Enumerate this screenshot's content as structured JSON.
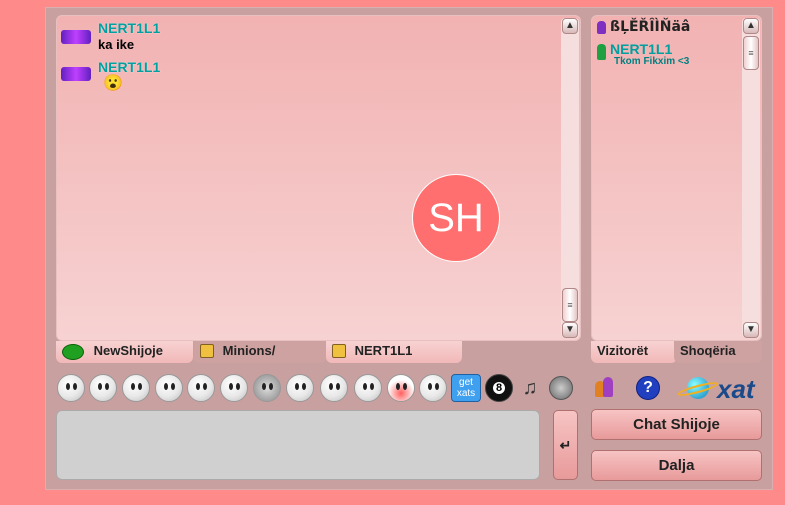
{
  "chat": {
    "messages": [
      {
        "user": "NERT1L1",
        "text": "ka ike"
      },
      {
        "user": "NERT1L1",
        "text": "😮"
      }
    ],
    "overlay_initials": "SH"
  },
  "tabs": {
    "main": "NewShijoje",
    "private1": "Minions/",
    "private2": "NERT1L1"
  },
  "userlist": {
    "users": [
      {
        "name": "ßĻĚŘÎÌŇäâ",
        "status": ""
      },
      {
        "name": "NERT1L1",
        "status": "Tkom Fikxim <3"
      }
    ],
    "tabs": [
      "Vizitorët",
      "Shoqëria"
    ]
  },
  "toolbar": {
    "get_xats": "get xats",
    "logo": "xat"
  },
  "input": {
    "send_symbol": "↵",
    "placeholder": ""
  },
  "buttons": {
    "chat": "Chat Shijoje",
    "logout": "Dalja"
  },
  "colors": {
    "background": "#ff8a8a",
    "name": "#00a0a0",
    "accent": "#ff6f6f"
  }
}
